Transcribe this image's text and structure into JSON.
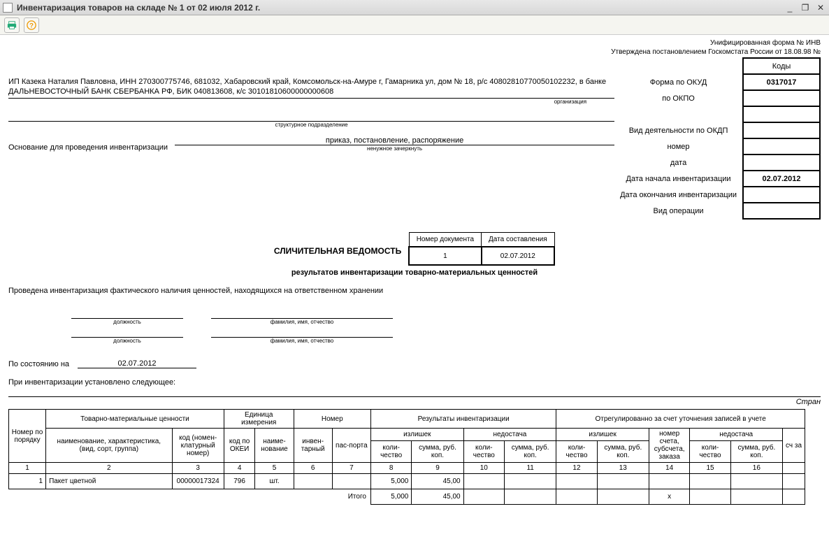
{
  "window": {
    "title": "Инвентаризация товаров на складе № 1 от 02 июля 2012 г."
  },
  "header": {
    "form_line": "Унифицированная форма № ИНВ",
    "approval_line": "Утверждена постановлением Госкомстата России от 18.08.98 №"
  },
  "codes": {
    "header": "Коды",
    "okud_label": "Форма по ОКУД",
    "okud": "0317017",
    "okpo_label": "по ОКПО",
    "okpo": "",
    "okdp_label": "Вид деятельности по ОКДП",
    "okdp": "",
    "number_label": "номер",
    "number": "",
    "date_label": "дата",
    "date": "",
    "start_label": "Дата начала инвентаризации",
    "start": "02.07.2012",
    "end_label": "Дата окончания инвентаризации",
    "end": "",
    "op_label": "Вид операции",
    "op": ""
  },
  "org": {
    "text1": "ИП Казека Наталия Павловна, ИНН 270300775746, 681032, Хабаровский край, Комсомольск-на-Амуре г, Гамарника ул, дом № 18, р/с 40802810770050102232, в банке",
    "text2": "ДАЛЬНЕВОСТОЧНЫЙ БАНК СБЕРБАНКА РФ, БИК 040813608, к/с 30101810600000000608",
    "caption_org": "организация",
    "caption_unit": "структурное подразделение"
  },
  "basis": {
    "label": "Основание для проведения инвентаризации",
    "value": "приказ, постановление, распоряжение",
    "caption": "ненужное зачеркнуть"
  },
  "doc_title": {
    "num_hdr": "Номер документа",
    "date_hdr": "Дата составления",
    "num": "1",
    "date": "02.07.2012",
    "main": "СЛИЧИТЕЛЬНАЯ ВЕДОМОСТЬ",
    "sub": "результатов инвентаризации товарно-материальных ценностей"
  },
  "para1": "Проведена инвентаризация фактического наличия ценностей, находящихся на ответственном хранении",
  "sig": {
    "post": "должность",
    "fio": "фамилия, имя, отчество"
  },
  "status": {
    "label": "По состоянию на",
    "date": "02.07.2012"
  },
  "para2": "При инвентаризации установлено следующее:",
  "page_label": "Стран",
  "table": {
    "h_num": "Номер по порядку",
    "h_tmc": "Товарно-материальные ценности",
    "h_unit": "Единица измерения",
    "h_number": "Номер",
    "h_results": "Результаты инвентаризации",
    "h_adjusted": "Отрегулированно за счет уточнения записей в учете",
    "h_name": "наименование, характеристика, (вид, сорт, группа)",
    "h_code": "код (номен-клатурный номер)",
    "h_okei": "код по ОКЕИ",
    "h_unitname": "наиме-нование",
    "h_inv": "инвен-тарный",
    "h_pass": "пас-порта",
    "h_surplus": "излишек",
    "h_shortage": "недостача",
    "h_qty": "коли-чество",
    "h_sum": "сумма, руб. коп.",
    "h_acct": "номер счета, субсчета, заказа",
    "h_col17": "сч за",
    "cols": [
      "1",
      "2",
      "3",
      "4",
      "5",
      "6",
      "7",
      "8",
      "9",
      "10",
      "11",
      "12",
      "13",
      "14",
      "15",
      "16"
    ],
    "row": {
      "n": "1",
      "name": "Пакет цветной",
      "code": "00000017324",
      "okei": "796",
      "unit": "шт.",
      "inv": "",
      "pass": "",
      "surplus_qty": "5,000",
      "surplus_sum": "45,00",
      "short_qty": "",
      "short_sum": "",
      "adj_s_qty": "",
      "adj_s_sum": "",
      "acct": "",
      "adj_sh_qty": "",
      "adj_sh_sum": ""
    },
    "total_label": "Итого",
    "total": {
      "surplus_qty": "5,000",
      "surplus_sum": "45,00",
      "x": "х"
    }
  }
}
